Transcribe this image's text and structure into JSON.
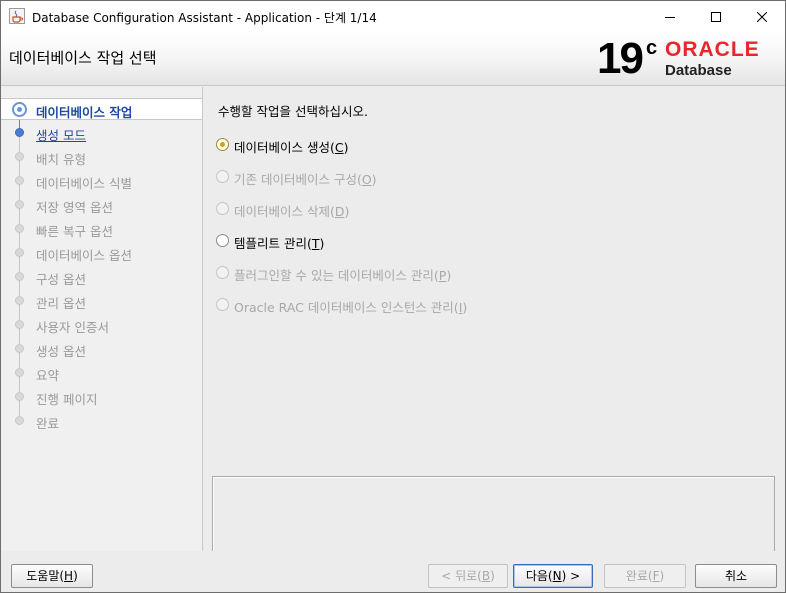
{
  "window": {
    "title": "Database Configuration Assistant - Application - 단계 1/14",
    "icon": "java-cup-icon"
  },
  "header": {
    "title": "데이터베이스 작업 선택",
    "logo": {
      "version": "19",
      "superscript": "c",
      "brand": "ORACLE",
      "product": "Database",
      "brand_color": "#e8272c"
    }
  },
  "steps": [
    {
      "label": "데이터베이스 작업",
      "state": "active"
    },
    {
      "label": "생성 모드",
      "state": "link"
    },
    {
      "label": "배치 유형",
      "state": "disabled"
    },
    {
      "label": "데이터베이스 식별",
      "state": "disabled"
    },
    {
      "label": "저장 영역 옵션",
      "state": "disabled"
    },
    {
      "label": "빠른 복구 옵션",
      "state": "disabled"
    },
    {
      "label": "데이터베이스 옵션",
      "state": "disabled"
    },
    {
      "label": "구성 옵션",
      "state": "disabled"
    },
    {
      "label": "관리 옵션",
      "state": "disabled"
    },
    {
      "label": "사용자 인증서",
      "state": "disabled"
    },
    {
      "label": "생성 옵션",
      "state": "disabled"
    },
    {
      "label": "요약",
      "state": "disabled"
    },
    {
      "label": "진행 페이지",
      "state": "disabled"
    },
    {
      "label": "완료",
      "state": "disabled"
    }
  ],
  "main": {
    "prompt": "수행할 작업을 선택하십시오.",
    "options": [
      {
        "pre": "데이터베이스 생성(",
        "key": "C",
        "post": ")",
        "checked": true,
        "enabled": true
      },
      {
        "pre": "기존 데이터베이스 구성(",
        "key": "O",
        "post": ")",
        "checked": false,
        "enabled": false
      },
      {
        "pre": "데이터베이스 삭제(",
        "key": "D",
        "post": ")",
        "checked": false,
        "enabled": false
      },
      {
        "pre": "템플리트 관리(",
        "key": "T",
        "post": ")",
        "checked": false,
        "enabled": true
      },
      {
        "pre": "플러그인할 수 있는 데이터베이스 관리(",
        "key": "P",
        "post": ")",
        "checked": false,
        "enabled": false
      },
      {
        "pre": "Oracle RAC 데이터베이스 인스턴스 관리(",
        "key": "I",
        "post": ")",
        "checked": false,
        "enabled": false
      }
    ]
  },
  "buttons": {
    "help": {
      "pre": "도움말(",
      "key": "H",
      "post": ")"
    },
    "back": {
      "pre": "< 뒤로(",
      "key": "B",
      "post": ")"
    },
    "next": {
      "pre": "다음(",
      "key": "N",
      "post": ") >"
    },
    "finish": {
      "pre": "완료(",
      "key": "F",
      "post": ")"
    },
    "cancel": {
      "label": "취소"
    }
  }
}
